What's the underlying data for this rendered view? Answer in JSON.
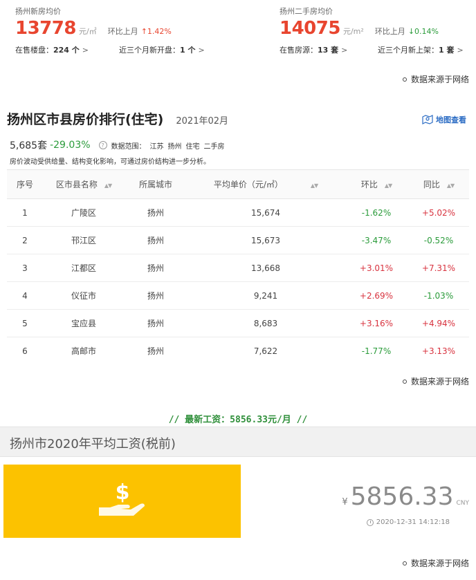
{
  "new_house": {
    "label": "扬州新房均价",
    "price": "13778",
    "unit": "元/㎡",
    "mom_label": "环比上月",
    "mom_value": "↑1.42%",
    "on_sale_label": "在售楼盘：",
    "on_sale_value": "224 个",
    "recent_label": "近三个月新开盘：",
    "recent_value": "1 个"
  },
  "second_hand": {
    "label": "扬州二手房均价",
    "price": "14075",
    "unit": "元/m²",
    "mom_label": "环比上月",
    "mom_value": "↓0.14%",
    "on_sale_label": "在售房源：",
    "on_sale_value": "13 套",
    "recent_label": "近三个月新上架：",
    "recent_value": "1 套"
  },
  "source_text": "数据来源于网络",
  "ranking": {
    "title": "扬州区市县房价排行(住宅)",
    "date": "2021年02月",
    "map_link": "地图查看",
    "count": "5,685套",
    "change": "-29.03%",
    "scope_label": "数据范围：",
    "scope_tags": [
      "江苏",
      "扬州",
      "住宅",
      "二手房"
    ],
    "note": "房价波动受供给量、结构变化影响，可通过房价结构进一步分析。",
    "columns": [
      "序号",
      "区市县名称",
      "所属城市",
      "平均单价（元/㎡）",
      "环比",
      "同比"
    ],
    "rows": [
      {
        "no": "1",
        "name": "广陵区",
        "city": "扬州",
        "price": "15,674",
        "mom": "-1.62%",
        "yoy": "+5.02%"
      },
      {
        "no": "2",
        "name": "邗江区",
        "city": "扬州",
        "price": "15,673",
        "mom": "-3.47%",
        "yoy": "-0.52%"
      },
      {
        "no": "3",
        "name": "江都区",
        "city": "扬州",
        "price": "13,668",
        "mom": "+3.01%",
        "yoy": "+7.31%"
      },
      {
        "no": "4",
        "name": "仪征市",
        "city": "扬州",
        "price": "9,241",
        "mom": "+2.69%",
        "yoy": "-1.03%"
      },
      {
        "no": "5",
        "name": "宝应县",
        "city": "扬州",
        "price": "8,683",
        "mom": "+3.16%",
        "yoy": "+4.94%"
      },
      {
        "no": "6",
        "name": "高邮市",
        "city": "扬州",
        "price": "7,622",
        "mom": "-1.77%",
        "yoy": "+3.13%"
      }
    ]
  },
  "wage": {
    "banner": "// 最新工资：5856.33元/月 //",
    "title": "扬州市2020年平均工资(税前)",
    "currency_symbol": "¥",
    "value": "5856.33",
    "currency_code": "CNY",
    "timestamp": "2020-12-31 14:12:18"
  },
  "colors": {
    "price_red": "#e8452f",
    "up_red": "#d8333f",
    "down_green": "#2a9b3a",
    "link_blue": "#2b6cc4",
    "wage_yellow": "#fcc200"
  }
}
